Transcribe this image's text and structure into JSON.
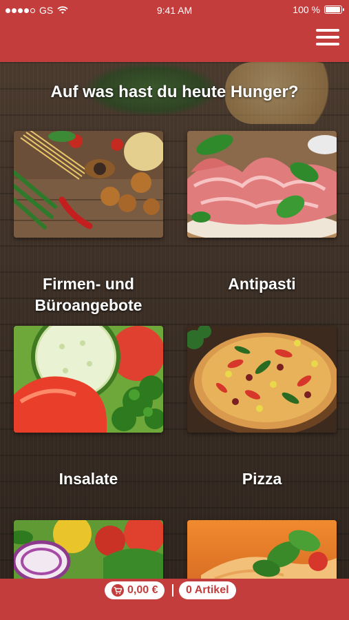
{
  "status_bar": {
    "carrier": "GS",
    "time": "9:41 AM",
    "battery": "100 %",
    "battery_level": 1.0
  },
  "header": {
    "menu_icon": "hamburger-menu-icon"
  },
  "main": {
    "headline": "Auf was hast du heute Hunger?",
    "categories": [
      {
        "label_line1": "Firmen- und",
        "label_line2": "Büroangebote",
        "image": "pasta-ingredients"
      },
      {
        "label_line1": "Antipasti",
        "label_line2": "",
        "image": "ham-platter"
      },
      {
        "label_line1": "Insalate",
        "label_line2": "",
        "image": "salad-tomato-cucumber"
      },
      {
        "label_line1": "Pizza",
        "label_line2": "",
        "image": "pizza"
      },
      {
        "label_line1": "",
        "label_line2": "",
        "image": "salad-onion-tomato"
      },
      {
        "label_line1": "",
        "label_line2": "",
        "image": "pasta-basil"
      }
    ]
  },
  "footer": {
    "cart_total": "0,00 €",
    "cart_icon": "shopping-cart-icon",
    "separator": "|",
    "item_count": "0 Artikel"
  },
  "colors": {
    "brand_red": "#c43d3d",
    "white": "#ffffff"
  }
}
